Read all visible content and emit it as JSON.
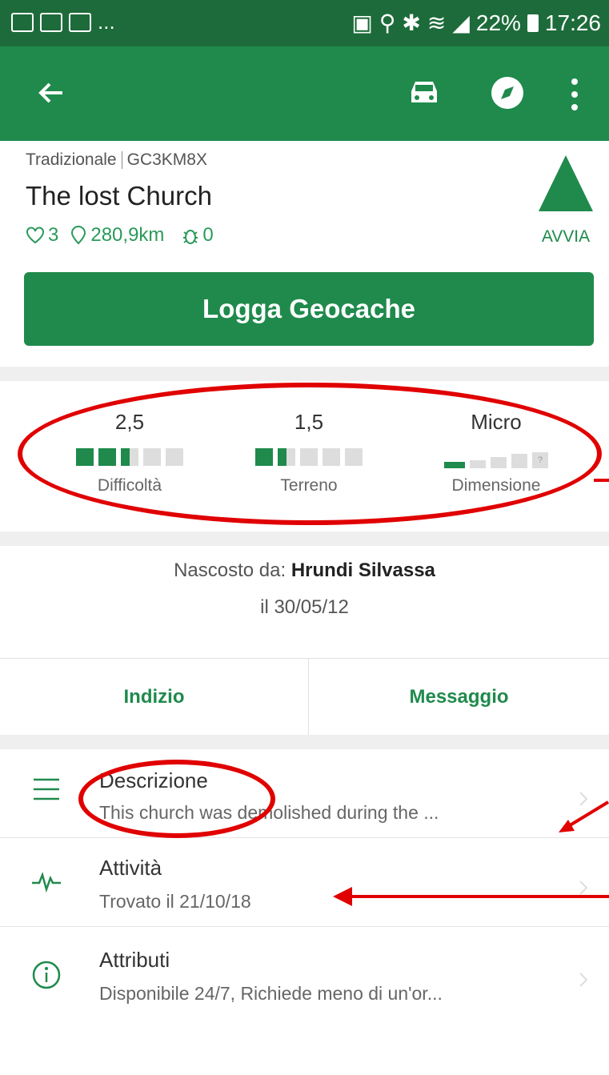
{
  "status_bar": {
    "left_more": "...",
    "battery": "22%",
    "time": "17:26"
  },
  "app_bar": {
    "icons": [
      "back-arrow-icon",
      "car-icon",
      "compass-icon",
      "more-vert-icon"
    ]
  },
  "header": {
    "cache_type": "Tradizionale",
    "cache_code": "GC3KM8X",
    "title": "The lost Church",
    "favorites": "3",
    "distance": "280,9km",
    "trackables": "0",
    "avvia_label": "AVVIA",
    "log_button": "Logga Geocache"
  },
  "ratings": {
    "difficulty": {
      "value": "2,5",
      "label": "Difficoltà",
      "level": 2.5,
      "max": 5
    },
    "terrain": {
      "value": "1,5",
      "label": "Terreno",
      "level": 1.5,
      "max": 5
    },
    "size": {
      "value": "Micro",
      "label": "Dimensione"
    }
  },
  "hidden_by": {
    "prefix": "Nascosto da:",
    "owner": "Hrundi Silvassa",
    "date": "il 30/05/12"
  },
  "tabs": {
    "hint": "Indizio",
    "message": "Messaggio"
  },
  "rows": [
    {
      "title": "Descrizione",
      "subtitle": "This church was demolished during the ..."
    },
    {
      "title": "Attività",
      "subtitle": "Trovato il 21/10/18"
    },
    {
      "title": "Attributi",
      "subtitle": "Disponibile 24/7, Richiede meno di un'or..."
    }
  ],
  "colors": {
    "primary": "#1f8a4c",
    "status_bar": "#1d6b3a",
    "annotation": "#e00000"
  }
}
